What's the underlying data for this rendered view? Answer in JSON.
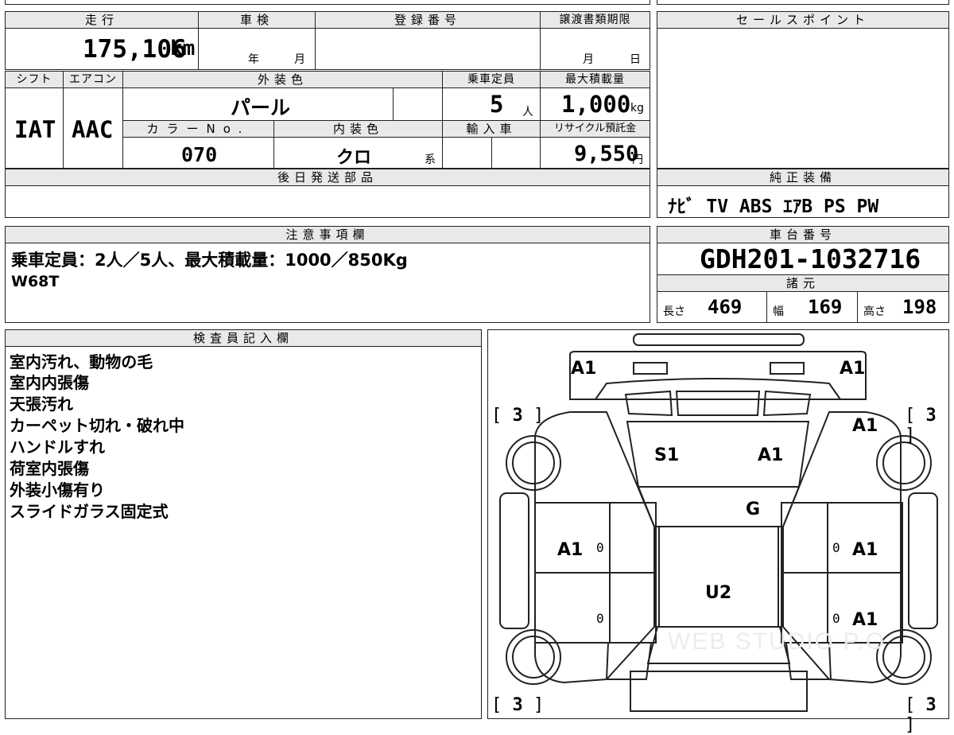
{
  "mileage": {
    "header": "走行",
    "value": "175,106",
    "unit": "km"
  },
  "shaken": {
    "header": "車検",
    "year_label": "年",
    "month_label": "月"
  },
  "registration": {
    "header": "登録番号"
  },
  "transfer": {
    "header": "譲渡書類期限",
    "month_label": "月",
    "day_label": "日"
  },
  "sales_point": {
    "header": "セールスポイント"
  },
  "shift": {
    "header": "シフト",
    "value": "IAT"
  },
  "aircon": {
    "header": "エアコン",
    "value": "AAC"
  },
  "exterior_color": {
    "header": "外装色",
    "value": "パール"
  },
  "capacity": {
    "header": "乗車定員",
    "value": "5",
    "unit": "人"
  },
  "max_load": {
    "header": "最大積載量",
    "value": "1,000",
    "unit": "kg"
  },
  "color_no": {
    "header": "カラーNo.",
    "value": "070"
  },
  "interior_color": {
    "header": "内装色",
    "value": "クロ",
    "suffix": "系"
  },
  "import": {
    "header": "輸入車"
  },
  "recycle": {
    "header": "リサイクル預託金",
    "value": "9,550",
    "unit": "円"
  },
  "later_parts": {
    "header": "後日発送部品"
  },
  "equipment": {
    "header": "純正装備",
    "value": "ﾅﾋﾞ TV ABS ｴｱB PS PW"
  },
  "caution": {
    "header": "注意事項欄",
    "line1": "乗車定員：2人／5人、最大積載量：1000／850Kg",
    "line2": "W68T"
  },
  "chassis": {
    "header": "車台番号",
    "value": "GDH201-1032716"
  },
  "specs": {
    "header": "諸元",
    "length_label": "長さ",
    "length": "469",
    "width_label": "幅",
    "width": "169",
    "height_label": "高さ",
    "height": "198"
  },
  "inspector": {
    "header": "検査員記入欄",
    "notes": [
      "室内汚れ、動物の毛",
      "室内内張傷",
      "天張汚れ",
      "カーペット切れ・破れ中",
      "ハンドルすれ",
      "荷室内張傷",
      "外装小傷有り",
      "スライドガラス固定式"
    ]
  },
  "diagram": {
    "marks": {
      "front_left": "A1",
      "front_right": "A1",
      "right_fender": "A1",
      "windshield_left": "S1",
      "windshield_right": "A1",
      "roof_front": "G",
      "left_door_front": "A1",
      "right_door_front": "A1",
      "roof": "U2",
      "right_door_rear": "A1"
    },
    "tire_tl": "3",
    "tire_tr": "3",
    "tire_bl": "3",
    "tire_br": "3",
    "zero": "0",
    "watermark": "WEB STUDIO P.O"
  }
}
